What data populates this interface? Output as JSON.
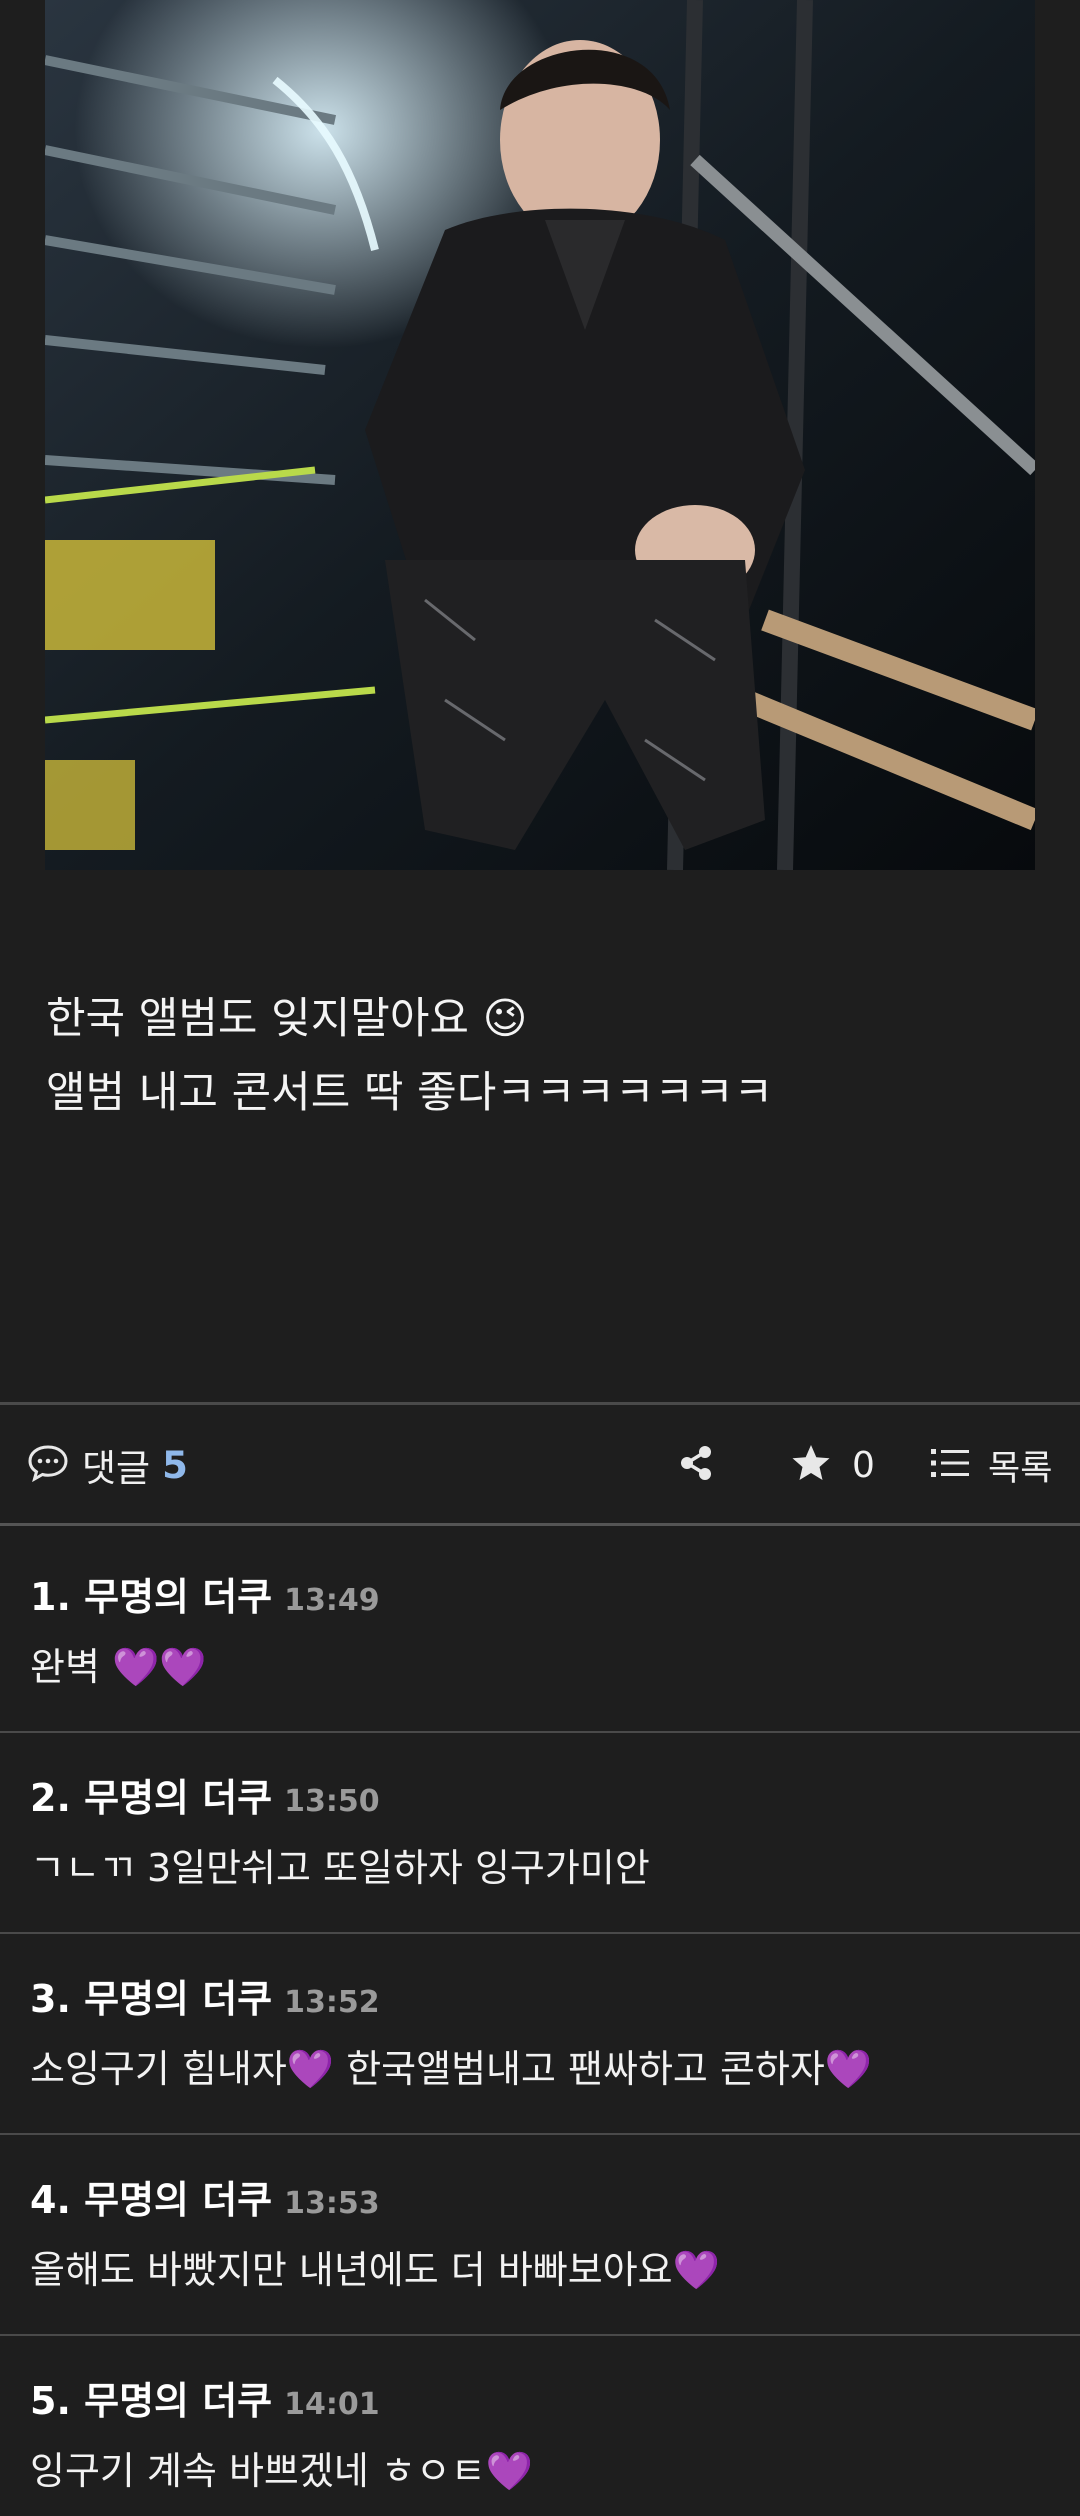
{
  "post": {
    "lines": [
      "한국 앨범도 잊지말아요 😉",
      "앨범 내고 콘서트 딱 좋다ㅋㅋㅋㅋㅋㅋㅋ"
    ]
  },
  "actions": {
    "comment_label": "댓글",
    "comment_count": "5",
    "star_count": "0",
    "list_label": "목록"
  },
  "comments": [
    {
      "author": "1. 무명의 더쿠",
      "time": "13:49",
      "text": "완벽 💜💜"
    },
    {
      "author": "2. 무명의 더쿠",
      "time": "13:50",
      "text": "ㄱㄴㄲ 3일만쉬고 또일하자 잉구가미안"
    },
    {
      "author": "3. 무명의 더쿠",
      "time": "13:52",
      "text": "소잉구기 힘내자💜 한국앨범내고 팬싸하고 콘하자💜"
    },
    {
      "author": "4. 무명의 더쿠",
      "time": "13:53",
      "text": "올해도 바빴지만 내년에도 더 바빠보아요💜"
    },
    {
      "author": "5. 무명의 더쿠",
      "time": "14:01",
      "text": "잉구기 계속 바쁘겠네 ㅎㅇㅌ💜"
    }
  ],
  "colors": {
    "background": "#1e1e1e",
    "comment_count_accent": "#8fb8ea",
    "heart": "#a63ff0",
    "timestamp": "#9a9a9a"
  },
  "icons": {
    "comment": "speech-bubble-icon",
    "share": "share-icon",
    "star": "star-icon",
    "list": "list-icon"
  }
}
